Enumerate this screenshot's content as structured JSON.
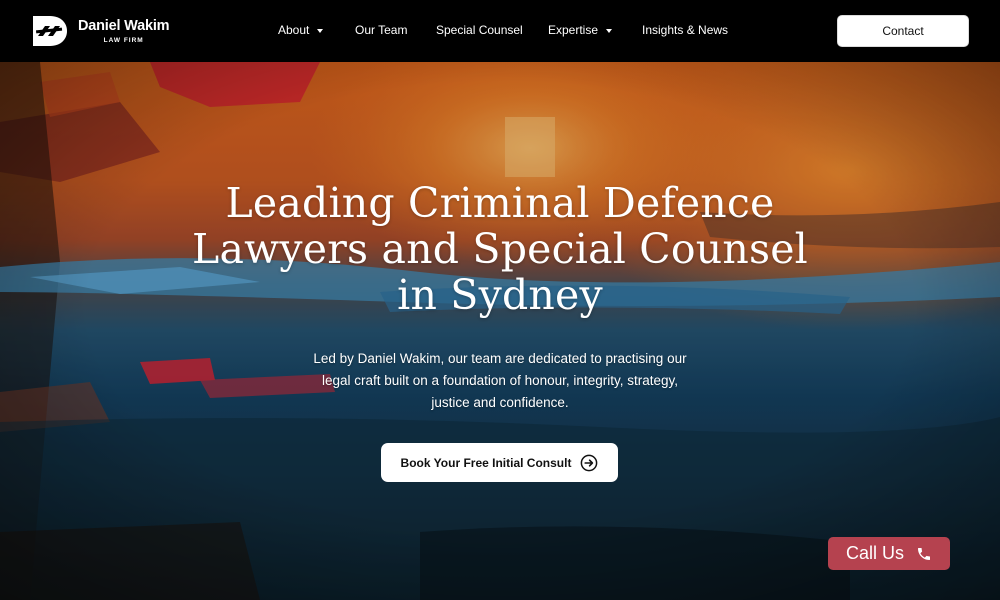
{
  "brand": {
    "name": "Daniel Wakim",
    "subtitle": "LAW FIRM"
  },
  "nav": {
    "items": [
      {
        "label": "About",
        "has_dropdown": true
      },
      {
        "label": "Our Team",
        "has_dropdown": false
      },
      {
        "label": "Special Counsel",
        "has_dropdown": false
      },
      {
        "label": "Expertise",
        "has_dropdown": true
      },
      {
        "label": "Insights & News",
        "has_dropdown": false
      }
    ],
    "contact_label": "Contact"
  },
  "hero": {
    "title_lines": [
      "Leading Criminal Defence",
      "Lawyers and Special Counsel",
      "in Sydney"
    ],
    "text_lines": [
      "Led by Daniel Wakim, our team are dedicated to practising our",
      "legal craft built on a foundation of honour, integrity, strategy,",
      "justice and confidence."
    ],
    "cta_label": "Book Your Free Initial Consult",
    "cta_icon": "arrow-right-circle-icon"
  },
  "call": {
    "label": "Call Us",
    "icon": "phone-icon"
  },
  "colors": {
    "header_bg": "#000000",
    "call_button": "#b5424f",
    "text": "#ffffff",
    "button_bg": "#ffffff"
  }
}
